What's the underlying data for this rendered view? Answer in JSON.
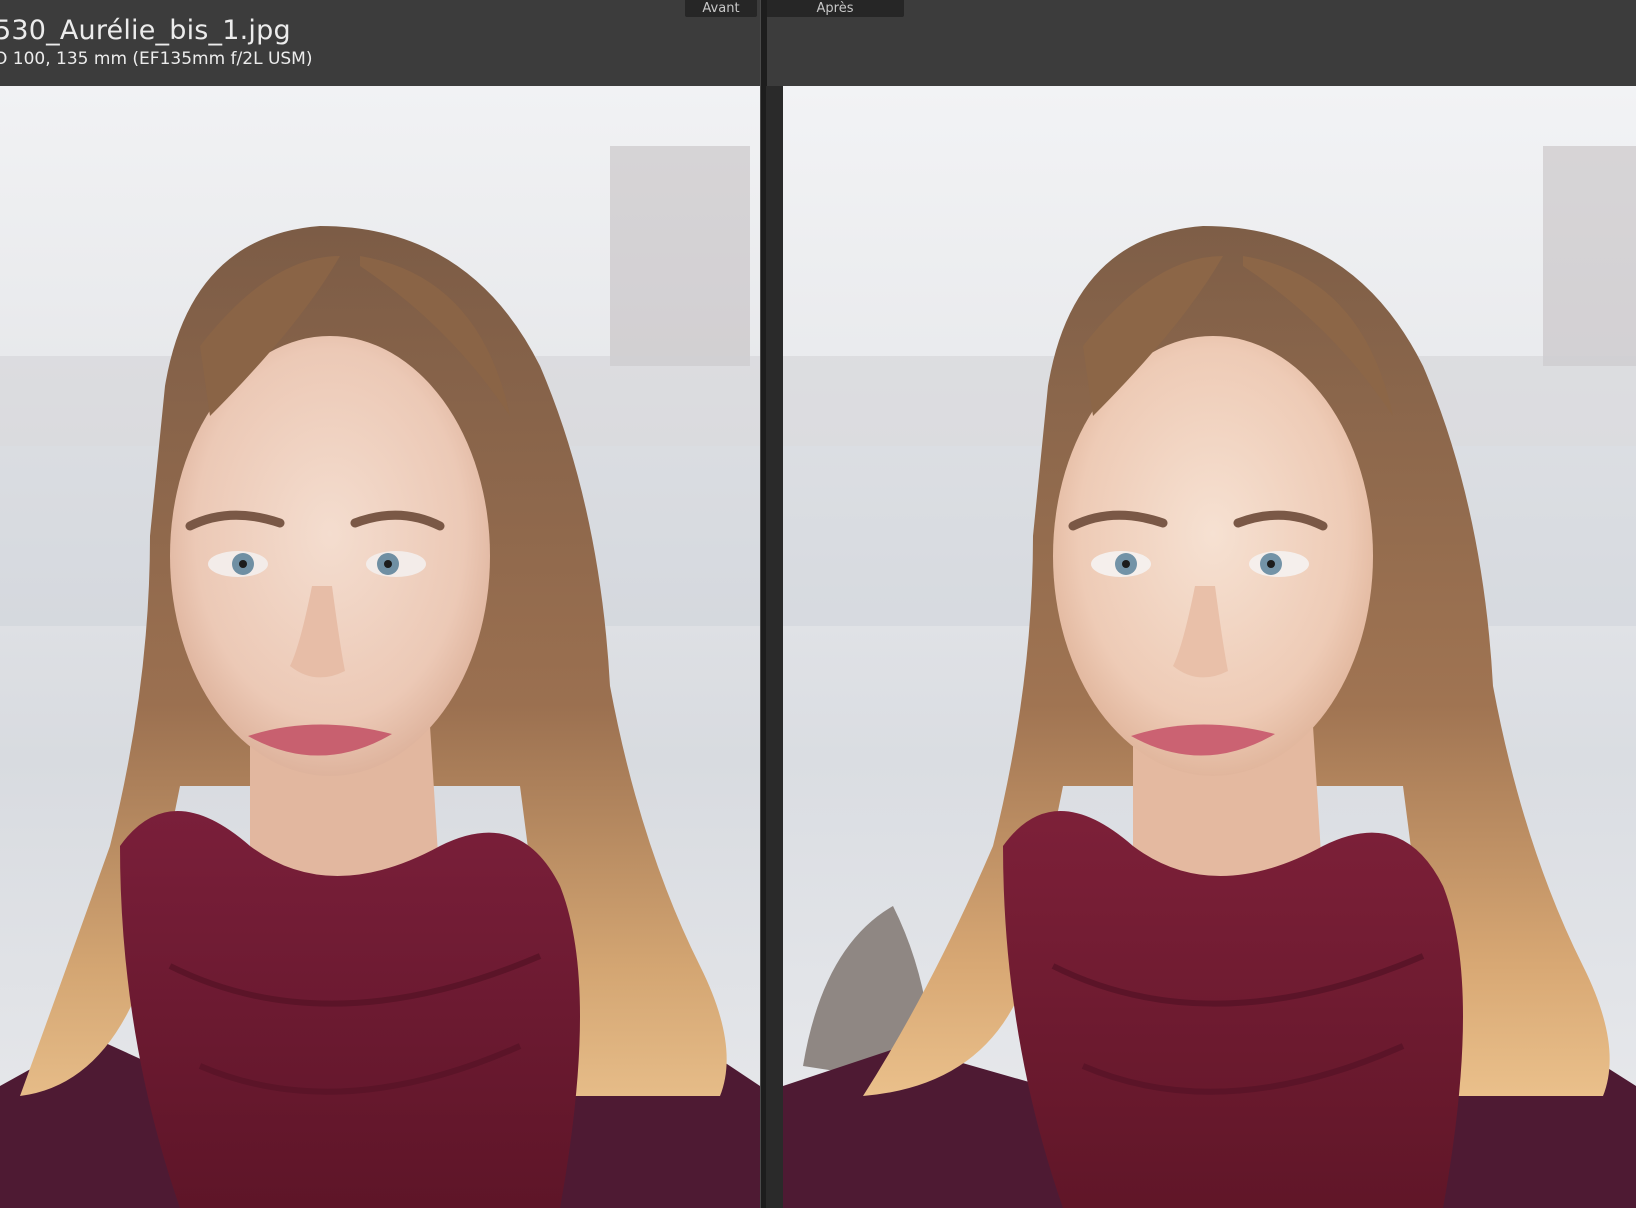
{
  "window": {
    "file_name": "530_Aurélie_bis_1.jpg",
    "file_meta": "O 100, 135 mm (EF135mm f/2L USM)"
  },
  "view": {
    "before_label": "Avant",
    "after_label": "Après"
  },
  "colors": {
    "toolbar": "#3c3c3c",
    "background": "#1d1d1d",
    "label_bg": "#262626",
    "scarf": "#7a1f3a",
    "hair": "#8a6446"
  }
}
